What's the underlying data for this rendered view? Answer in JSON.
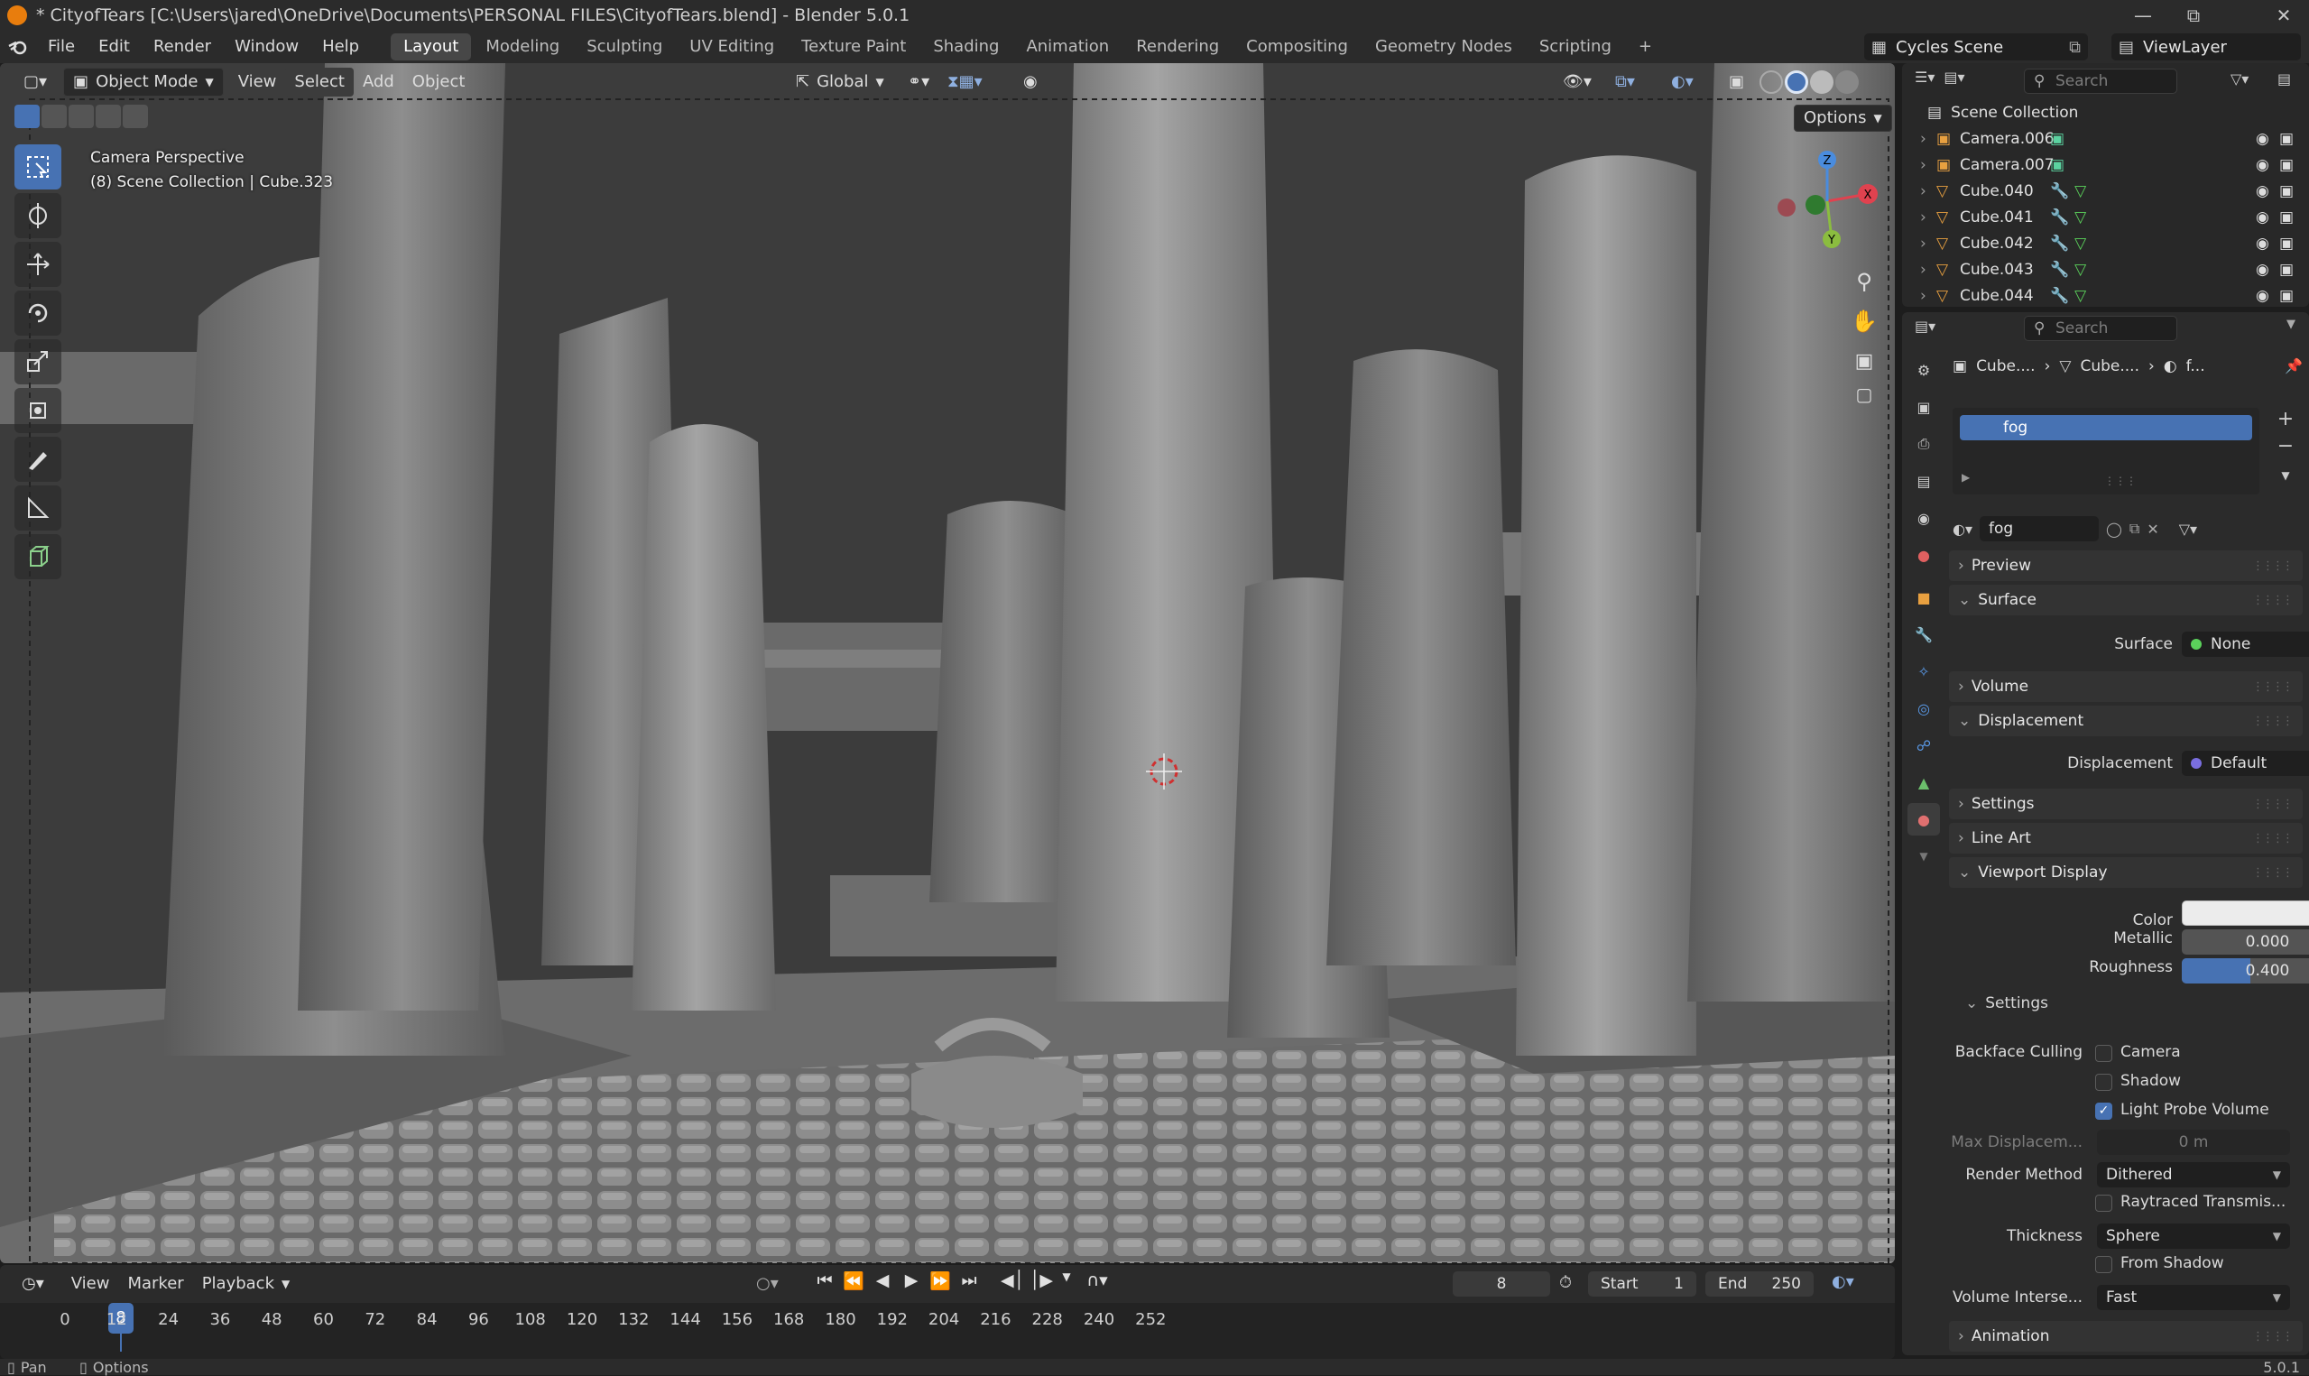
{
  "titlebar": {
    "title": "* CityofTears [C:\\Users\\jared\\OneDrive\\Documents\\PERSONAL FILES\\CityofTears.blend] - Blender 5.0.1",
    "minimize_icon": "minimize-icon",
    "maximize_icon": "maximize-icon",
    "close_icon": "close-icon"
  },
  "menubar": {
    "menus": [
      "File",
      "Edit",
      "Render",
      "Window",
      "Help"
    ],
    "workspaces": [
      "Layout",
      "Modeling",
      "Sculpting",
      "UV Editing",
      "Texture Paint",
      "Shading",
      "Animation",
      "Rendering",
      "Compositing",
      "Geometry Nodes",
      "Scripting"
    ],
    "active_workspace": "Layout",
    "add_workspace": "+",
    "scene": "Cycles Scene",
    "view_layer": "ViewLayer"
  },
  "viewport": {
    "mode": "Object Mode",
    "menus": [
      "View",
      "Select",
      "Add",
      "Object"
    ],
    "transform_orientation": "Global",
    "options_label": "Options",
    "info_line1": "Camera Perspective",
    "info_line2": "(8) Scene Collection | Cube.323",
    "tools": [
      "select-box-icon",
      "cursor-icon",
      "move-icon",
      "rotate-icon",
      "scale-icon",
      "transform-icon",
      "annotate-icon",
      "measure-icon",
      "add-cube-icon"
    ],
    "gizmo_axes": [
      "X",
      "Y",
      "Z"
    ]
  },
  "timeline": {
    "menus": [
      "View",
      "Marker",
      "Playback"
    ],
    "current_frame": "8",
    "start_label": "Start",
    "start_value": "1",
    "end_label": "End",
    "end_value": "250",
    "ticks": [
      "0",
      "12",
      "24",
      "36",
      "48",
      "60",
      "72",
      "84",
      "96",
      "108",
      "120",
      "132",
      "144",
      "156",
      "168",
      "180",
      "192",
      "204",
      "216",
      "228",
      "240",
      "252"
    ]
  },
  "statusbar": {
    "left1": "Pan",
    "left2": "Options",
    "version": "5.0.1"
  },
  "outliner": {
    "search_placeholder": "Search",
    "root": "Scene Collection",
    "items": [
      {
        "name": "Camera.006",
        "type": "camera"
      },
      {
        "name": "Camera.007",
        "type": "camera"
      },
      {
        "name": "Cube.040",
        "type": "mesh"
      },
      {
        "name": "Cube.041",
        "type": "mesh"
      },
      {
        "name": "Cube.042",
        "type": "mesh"
      },
      {
        "name": "Cube.043",
        "type": "mesh"
      },
      {
        "name": "Cube.044",
        "type": "mesh"
      }
    ]
  },
  "properties": {
    "search_placeholder": "Search",
    "breadcrumb": [
      "Cube....",
      "Cube....",
      "f..."
    ],
    "material_slot": "fog",
    "material_name": "fog",
    "panels": {
      "preview": "Preview",
      "surface": "Surface",
      "surface_label": "Surface",
      "surface_value": "None",
      "volume": "Volume",
      "displacement": "Displacement",
      "displacement_label": "Displacement",
      "displacement_value": "Default",
      "settings": "Settings",
      "line_art": "Line Art",
      "viewport_display": "Viewport Display",
      "color_label": "Color",
      "metallic_label": "Metallic",
      "metallic_value": "0.000",
      "roughness_label": "Roughness",
      "roughness_value": "0.400",
      "roughness_fraction": 0.4,
      "sub_settings": "Settings",
      "backface_culling": "Backface Culling",
      "camera": "Camera",
      "shadow": "Shadow",
      "light_probe_volume": "Light Probe Volume",
      "max_displacement": "Max Displacem...",
      "max_displacement_value": "0 m",
      "render_method": "Render Method",
      "render_method_value": "Dithered",
      "raytraced_transmission": "Raytraced Transmis...",
      "thickness": "Thickness",
      "thickness_value": "Sphere",
      "from_shadow": "From Shadow",
      "volume_intersection": "Volume Interse...",
      "volume_intersection_value": "Fast",
      "animation": "Animation"
    }
  },
  "colors": {
    "accent": "#4772b3",
    "x_axis": "#e0424f",
    "y_axis": "#8bbd3f",
    "z_axis": "#4a8cde",
    "blender_orange": "#e87d0d"
  }
}
